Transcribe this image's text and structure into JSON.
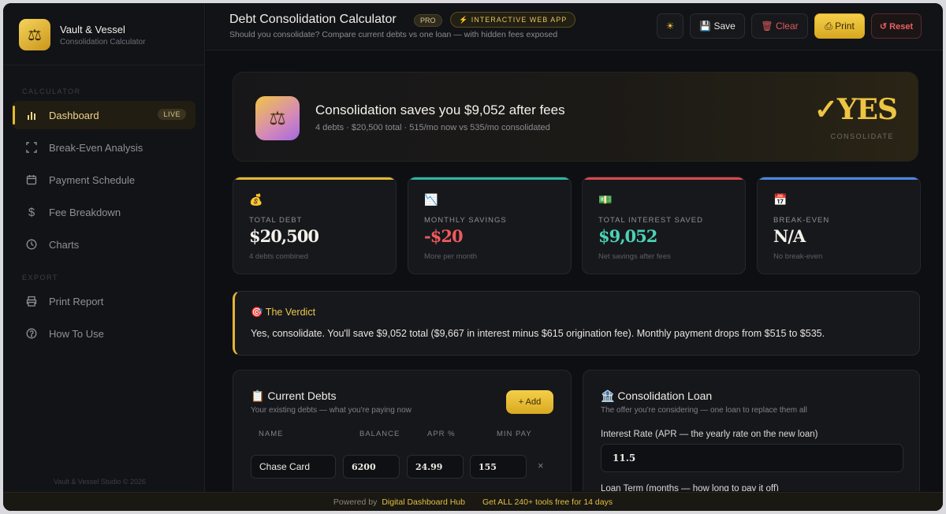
{
  "brand": {
    "title": "Vault & Vessel",
    "subtitle": "Consolidation Calculator",
    "footer": "Vault & Vessel Studio © 2026"
  },
  "sidebar": {
    "section_calculator": "CALCULATOR",
    "section_export": "EXPORT",
    "items": [
      {
        "label": "Dashboard",
        "icon": "bar-chart-icon",
        "badge": "LIVE",
        "active": true
      },
      {
        "label": "Break-Even Analysis",
        "icon": "focus-frame-icon"
      },
      {
        "label": "Payment Schedule",
        "icon": "calendar-icon"
      },
      {
        "label": "Fee Breakdown",
        "icon": "dollar-icon"
      },
      {
        "label": "Charts",
        "icon": "clock-icon"
      },
      {
        "label": "Print Report",
        "icon": "printer-icon"
      },
      {
        "label": "How To Use",
        "icon": "help-icon"
      }
    ]
  },
  "header": {
    "title": "Debt Consolidation Calculator",
    "pro_badge": "PRO",
    "app_badge": "⚡ INTERACTIVE WEB APP",
    "subtitle": "Should you consolidate? Compare current debts vs one loan — with hidden fees exposed",
    "save_label": "💾 Save",
    "clear_label": "🗑 Clear",
    "print_label": "⎙ Print",
    "reset_label": "↺ Reset"
  },
  "hero": {
    "title": "Consolidation saves you $9,052 after fees",
    "subtitle": "4 debts · $20,500 total · 515/mo now vs 535/mo consolidated",
    "verdict": "✓YES",
    "verdict_sub": "CONSOLIDATE"
  },
  "cards": [
    {
      "icon": "💰",
      "label": "TOTAL DEBT",
      "value": "$20,500",
      "note": "4 debts combined",
      "color": "#f3f1ea"
    },
    {
      "icon": "📉",
      "label": "MONTHLY SAVINGS",
      "value": "-$20",
      "note": "More per month",
      "color": "#ee5a5e"
    },
    {
      "icon": "💵",
      "label": "TOTAL INTEREST SAVED",
      "value": "$9,052",
      "note": "Net savings after fees",
      "color": "#4ad3b7"
    },
    {
      "icon": "📅",
      "label": "BREAK-EVEN",
      "value": "N/A",
      "note": "No break-even",
      "color": "#f3f1ea"
    }
  ],
  "verdict": {
    "title": "🎯 The Verdict",
    "text": "Yes, consolidate. You'll save $9,052 total ($9,667 in interest minus $615 origination fee). Monthly payment drops from $515 to $535."
  },
  "debts": {
    "title": "📋 Current Debts",
    "subtitle": "Your existing debts — what you're paying now",
    "add_label": "+ Add",
    "columns": [
      "NAME",
      "BALANCE",
      "APR %",
      "MIN PAY"
    ],
    "rows": [
      {
        "name": "Chase Card",
        "balance": "6200",
        "apr": "24.99",
        "min_pay": "155",
        "delete": "×"
      }
    ]
  },
  "loan": {
    "title": "🏦 Consolidation Loan",
    "subtitle": "The offer you're considering — one loan to replace them all",
    "rate_label": "Interest Rate (APR — the yearly rate on the new loan)",
    "rate_value": "11.5",
    "term_label": "Loan Term (months — how long to pay it off)"
  },
  "footer": {
    "powered": "Powered by",
    "hub": "Digital Dashboard Hub",
    "promo": "Get ALL 240+ tools free for 14 days"
  }
}
